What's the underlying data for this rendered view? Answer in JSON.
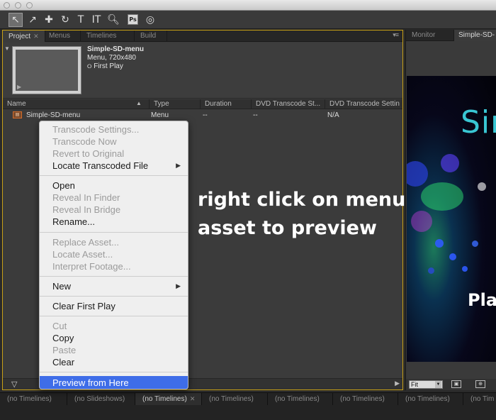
{
  "toolbar": {
    "tools": [
      "selection-tool",
      "direct-select-tool",
      "add-tool",
      "rotate-tool",
      "text-tool",
      "vertical-text-tool",
      "zoom-tool",
      "photoshop-tool",
      "disc-tool"
    ],
    "ps_label": "Ps"
  },
  "project_panel": {
    "tabs": [
      {
        "label": "Project",
        "active": true
      },
      {
        "label": "Menus"
      },
      {
        "label": "Timelines"
      },
      {
        "label": "Build"
      }
    ],
    "preview": {
      "asset_name": "Simple-SD-menu",
      "asset_info": "Menu, 720x480",
      "first_play": "First Play"
    },
    "columns": [
      "Name",
      "Type",
      "Duration",
      "DVD Transcode St...",
      "DVD Transcode Settin"
    ],
    "rows": [
      {
        "name": "Simple-SD-menu",
        "type": "Menu",
        "duration": "--",
        "transcode_status": "--",
        "transcode_settings": "N/A"
      }
    ]
  },
  "monitor_panel": {
    "tabs": [
      {
        "label": "Monitor"
      },
      {
        "label": "Simple-SD-",
        "active": true
      }
    ],
    "preview_word1": "Sim",
    "preview_word2": "Pla",
    "zoom": "Fit"
  },
  "context_menu": {
    "groups": [
      [
        {
          "label": "Transcode Settings...",
          "disabled": true
        },
        {
          "label": "Transcode Now",
          "disabled": true
        },
        {
          "label": "Revert to Original",
          "disabled": true
        },
        {
          "label": "Locate Transcoded File",
          "submenu": true
        }
      ],
      [
        {
          "label": "Open"
        },
        {
          "label": "Reveal In Finder",
          "disabled": true
        },
        {
          "label": "Reveal In Bridge",
          "disabled": true
        },
        {
          "label": "Rename..."
        }
      ],
      [
        {
          "label": "Replace Asset...",
          "disabled": true
        },
        {
          "label": "Locate Asset...",
          "disabled": true
        },
        {
          "label": "Interpret Footage...",
          "disabled": true
        }
      ],
      [
        {
          "label": "New",
          "submenu": true
        }
      ],
      [
        {
          "label": "Clear First Play"
        }
      ],
      [
        {
          "label": "Cut",
          "disabled": true
        },
        {
          "label": "Copy"
        },
        {
          "label": "Paste",
          "disabled": true
        },
        {
          "label": "Clear"
        }
      ],
      [
        {
          "label": "Preview from Here",
          "highlighted": true
        }
      ]
    ]
  },
  "annotation": {
    "line1": "right click on menu",
    "line2": "asset to preview"
  },
  "timeline_tabs": [
    "(no Timelines)",
    "(no Slideshows)",
    "(no Timelines)",
    "(no Timelines)",
    "(no Timelines)",
    "(no Timelines)",
    "(no Timelines)",
    "(no Tim"
  ],
  "colors": {
    "accent_highlight": "#3e6de8",
    "panel_focus_border": "#c8a016",
    "preview_text": "#39c6d3"
  }
}
